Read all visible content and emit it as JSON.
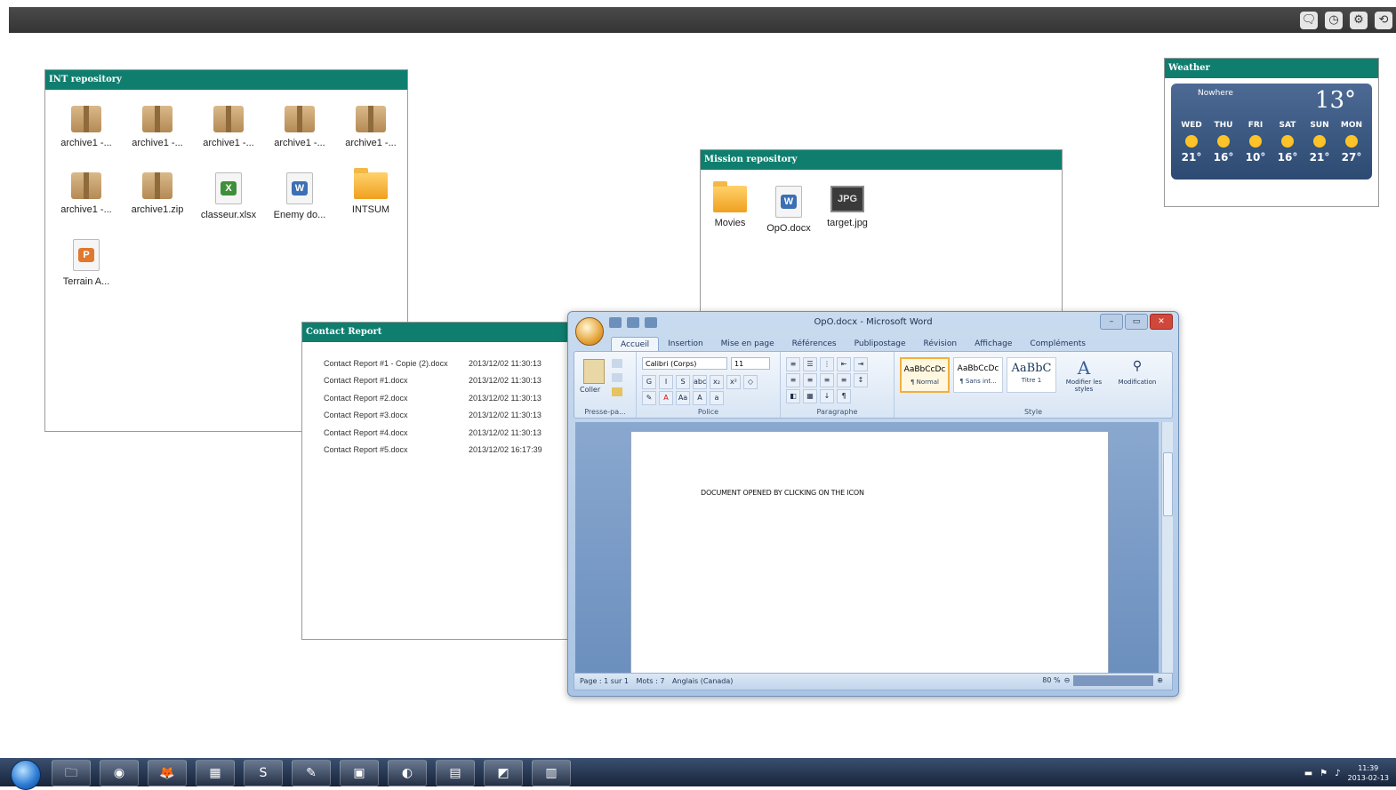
{
  "topbar": {
    "icons": [
      "🗨",
      "◷",
      "⚙",
      "⟲"
    ]
  },
  "int_repo": {
    "title": "INT repository",
    "files": [
      {
        "name": "archive1 -...",
        "kind": "zip"
      },
      {
        "name": "archive1 -...",
        "kind": "zip"
      },
      {
        "name": "archive1 -...",
        "kind": "zip"
      },
      {
        "name": "archive1 -...",
        "kind": "zip"
      },
      {
        "name": "archive1 -...",
        "kind": "zip"
      },
      {
        "name": "archive1 -...",
        "kind": "zip"
      },
      {
        "name": "archive1.zip",
        "kind": "zip"
      },
      {
        "name": "classeur.xlsx",
        "kind": "xlsx"
      },
      {
        "name": "Enemy do...",
        "kind": "docx"
      },
      {
        "name": "INTSUM",
        "kind": "folder"
      },
      {
        "name": "Terrain A...",
        "kind": "ppt"
      }
    ]
  },
  "mission_repo": {
    "title": "Mission repository",
    "files": [
      {
        "name": "Movies",
        "kind": "folder"
      },
      {
        "name": "OpO.docx",
        "kind": "docx"
      },
      {
        "name": "target.jpg",
        "kind": "jpg",
        "badge": "JPG"
      }
    ]
  },
  "weather": {
    "title": "Weather",
    "location": "Nowhere",
    "current_temp": "13°",
    "days": [
      {
        "day": "WED",
        "temp": "21°"
      },
      {
        "day": "THU",
        "temp": "16°"
      },
      {
        "day": "FRI",
        "temp": "10°"
      },
      {
        "day": "SAT",
        "temp": "16°"
      },
      {
        "day": "SUN",
        "temp": "21°"
      },
      {
        "day": "MON",
        "temp": "27°"
      }
    ]
  },
  "contact_report": {
    "title": "Contact Report",
    "rows": [
      {
        "name": "Contact Report #1 - Copie (2).docx",
        "date": "2013/12/02 11:30:13"
      },
      {
        "name": "Contact Report #1.docx",
        "date": "2013/12/02 11:30:13"
      },
      {
        "name": "Contact Report #2.docx",
        "date": "2013/12/02 11:30:13"
      },
      {
        "name": "Contact Report #3.docx",
        "date": "2013/12/02 11:30:13"
      },
      {
        "name": "Contact Report #4.docx",
        "date": "2013/12/02 11:30:13"
      },
      {
        "name": "Contact Report #5.docx",
        "date": "2013/12/02 16:17:39"
      }
    ]
  },
  "word": {
    "title": "OpO.docx - Microsoft Word",
    "tabs": [
      "Accueil",
      "Insertion",
      "Mise en page",
      "Références",
      "Publipostage",
      "Révision",
      "Affichage",
      "Compléments"
    ],
    "font_name": "Calibri (Corps)",
    "font_size": "11",
    "groups": {
      "clipboard": "Presse-pa...",
      "font": "Police",
      "paragraph": "Paragraphe",
      "style": "Style"
    },
    "paste_label": "Coller",
    "styles": [
      {
        "preview": "AaBbCcDc",
        "name": "¶ Normal"
      },
      {
        "preview": "AaBbCcDc",
        "name": "¶ Sans int..."
      },
      {
        "preview": "AaBbC",
        "name": "Titre 1"
      }
    ],
    "modify_styles": "Modifier les styles",
    "editing": "Modification",
    "document_text": "DOCUMENT OPENED BY CLICKING ON THE ICON",
    "status": {
      "page": "Page : 1 sur 1",
      "words": "Mots : 7",
      "language": "Anglais (Canada)",
      "zoom": "80 %"
    }
  },
  "taskbar": {
    "apps": [
      "🗀",
      "◉",
      "🦊",
      "▦",
      "S",
      "✎",
      "▣",
      "◐",
      "▤",
      "◩",
      "▥"
    ],
    "clock_time": "11:39",
    "clock_date": "2013-02-13"
  }
}
